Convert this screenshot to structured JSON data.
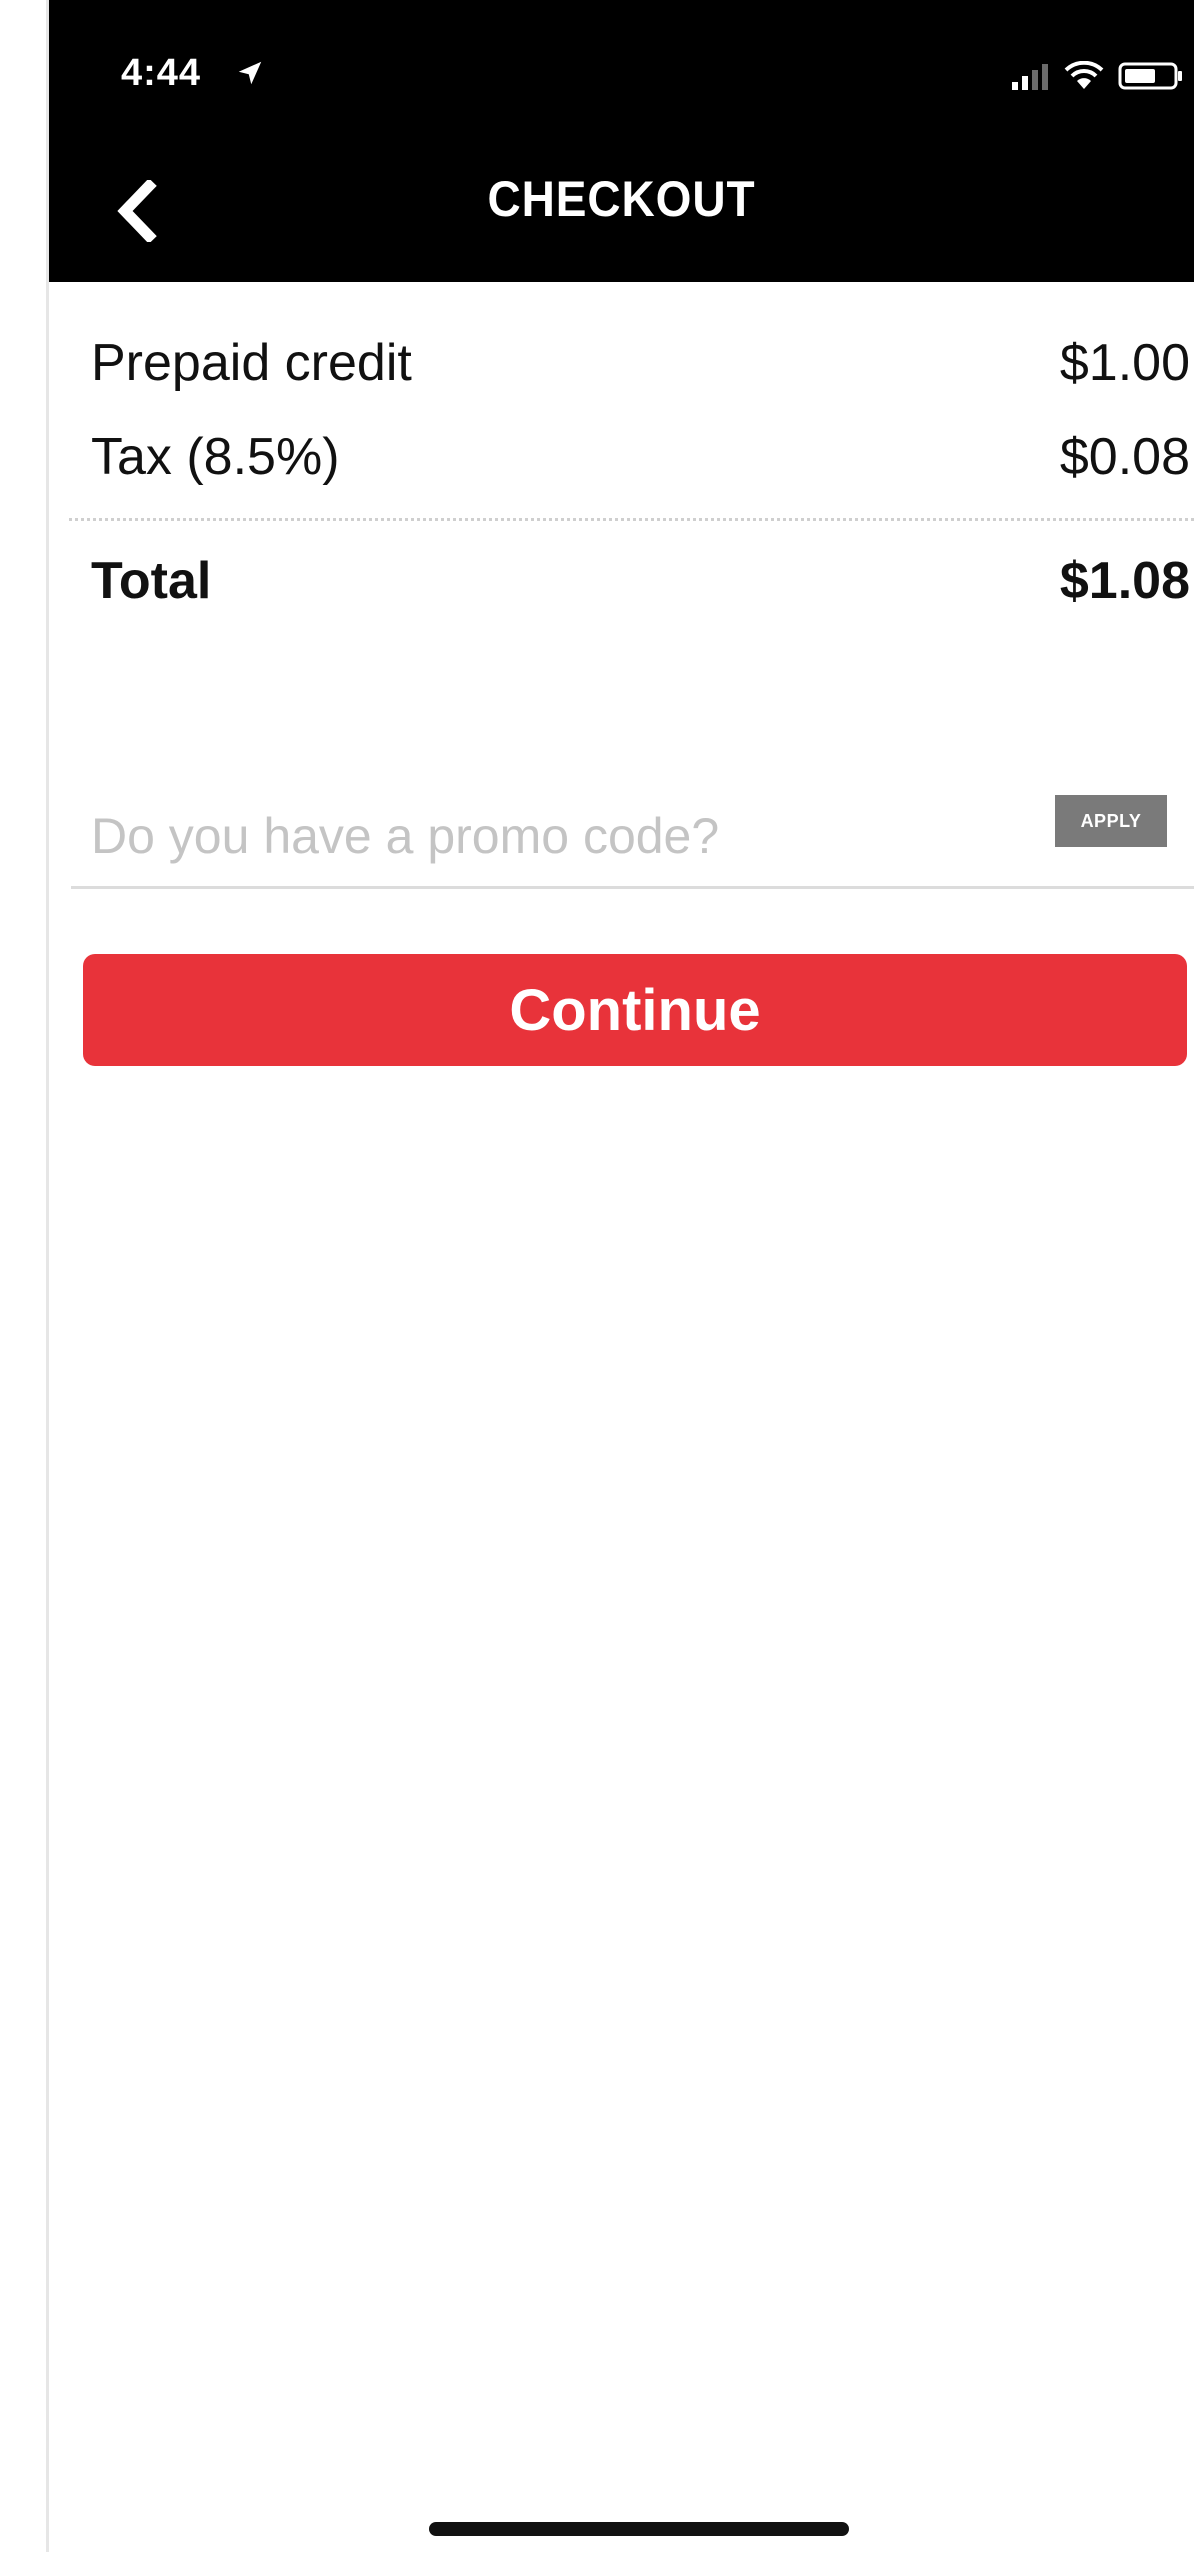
{
  "status_bar": {
    "time": "4:44",
    "icons": [
      "location-arrow-icon",
      "signal-icon",
      "wifi-icon",
      "battery-icon"
    ]
  },
  "header": {
    "title": "CHECKOUT",
    "back_icon": "chevron-left-icon"
  },
  "summary": {
    "prepaid_label": "Prepaid credit",
    "prepaid_value": "$1.00",
    "tax_label": "Tax (8.5%)",
    "tax_value": "$0.08",
    "total_label": "Total",
    "total_value": "$1.08"
  },
  "promo": {
    "placeholder": "Do you have a promo code?",
    "value": "",
    "apply_label": "APPLY"
  },
  "actions": {
    "continue_label": "Continue"
  },
  "colors": {
    "header_bg": "#000000",
    "continue_bg": "#e8333a",
    "apply_bg": "#7a7a7a"
  }
}
